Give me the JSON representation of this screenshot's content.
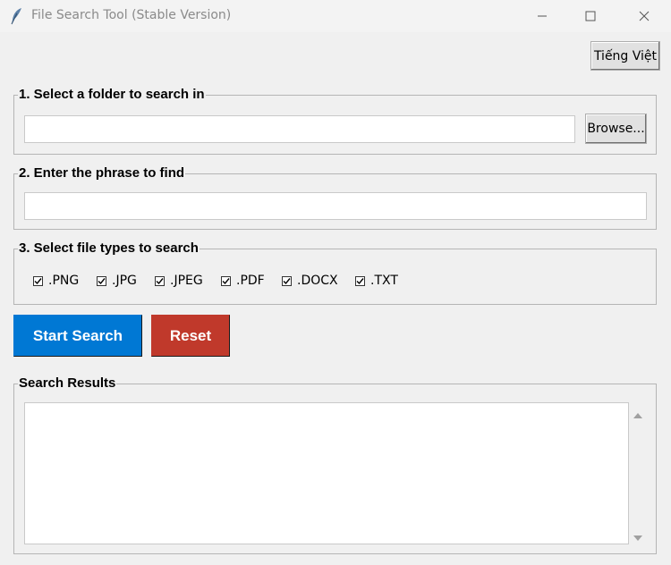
{
  "window": {
    "title": "File Search Tool (Stable Version)"
  },
  "header": {
    "language_button": "Tiếng Việt"
  },
  "folder_section": {
    "legend": "1. Select a folder to search in",
    "folder_value": "",
    "browse_label": "Browse..."
  },
  "phrase_section": {
    "legend": "2. Enter the phrase to find",
    "phrase_value": ""
  },
  "filetype_section": {
    "legend": "3. Select file types to search",
    "types": [
      {
        "label": ".PNG",
        "checked": true
      },
      {
        "label": ".JPG",
        "checked": true
      },
      {
        "label": ".JPEG",
        "checked": true
      },
      {
        "label": ".PDF",
        "checked": true
      },
      {
        "label": ".DOCX",
        "checked": true
      },
      {
        "label": ".TXT",
        "checked": true
      }
    ]
  },
  "actions": {
    "start_label": "Start Search",
    "reset_label": "Reset",
    "start_color": "#0078d4",
    "reset_color": "#c0392b"
  },
  "results_section": {
    "legend": "Search Results",
    "content": ""
  }
}
